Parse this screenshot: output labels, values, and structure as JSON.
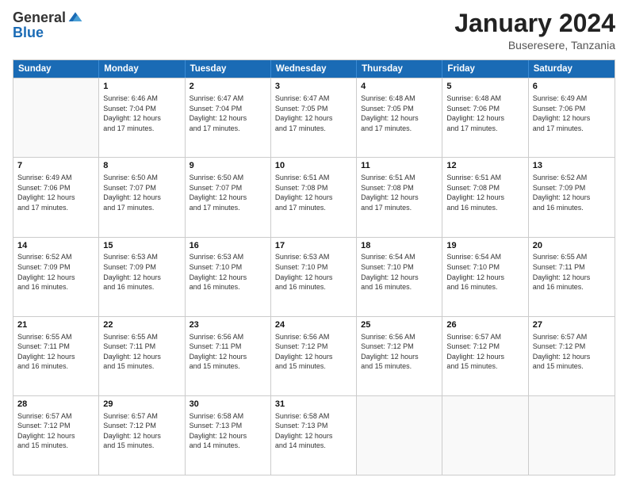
{
  "header": {
    "logo_general": "General",
    "logo_blue": "Blue",
    "month_title": "January 2024",
    "subtitle": "Buseresere, Tanzania"
  },
  "weekdays": [
    "Sunday",
    "Monday",
    "Tuesday",
    "Wednesday",
    "Thursday",
    "Friday",
    "Saturday"
  ],
  "rows": [
    [
      {
        "day": "",
        "info": "",
        "empty": true
      },
      {
        "day": "1",
        "info": "Sunrise: 6:46 AM\nSunset: 7:04 PM\nDaylight: 12 hours\nand 17 minutes."
      },
      {
        "day": "2",
        "info": "Sunrise: 6:47 AM\nSunset: 7:04 PM\nDaylight: 12 hours\nand 17 minutes."
      },
      {
        "day": "3",
        "info": "Sunrise: 6:47 AM\nSunset: 7:05 PM\nDaylight: 12 hours\nand 17 minutes."
      },
      {
        "day": "4",
        "info": "Sunrise: 6:48 AM\nSunset: 7:05 PM\nDaylight: 12 hours\nand 17 minutes."
      },
      {
        "day": "5",
        "info": "Sunrise: 6:48 AM\nSunset: 7:06 PM\nDaylight: 12 hours\nand 17 minutes."
      },
      {
        "day": "6",
        "info": "Sunrise: 6:49 AM\nSunset: 7:06 PM\nDaylight: 12 hours\nand 17 minutes."
      }
    ],
    [
      {
        "day": "7",
        "info": "Sunrise: 6:49 AM\nSunset: 7:06 PM\nDaylight: 12 hours\nand 17 minutes."
      },
      {
        "day": "8",
        "info": "Sunrise: 6:50 AM\nSunset: 7:07 PM\nDaylight: 12 hours\nand 17 minutes."
      },
      {
        "day": "9",
        "info": "Sunrise: 6:50 AM\nSunset: 7:07 PM\nDaylight: 12 hours\nand 17 minutes."
      },
      {
        "day": "10",
        "info": "Sunrise: 6:51 AM\nSunset: 7:08 PM\nDaylight: 12 hours\nand 17 minutes."
      },
      {
        "day": "11",
        "info": "Sunrise: 6:51 AM\nSunset: 7:08 PM\nDaylight: 12 hours\nand 17 minutes."
      },
      {
        "day": "12",
        "info": "Sunrise: 6:51 AM\nSunset: 7:08 PM\nDaylight: 12 hours\nand 16 minutes."
      },
      {
        "day": "13",
        "info": "Sunrise: 6:52 AM\nSunset: 7:09 PM\nDaylight: 12 hours\nand 16 minutes."
      }
    ],
    [
      {
        "day": "14",
        "info": "Sunrise: 6:52 AM\nSunset: 7:09 PM\nDaylight: 12 hours\nand 16 minutes."
      },
      {
        "day": "15",
        "info": "Sunrise: 6:53 AM\nSunset: 7:09 PM\nDaylight: 12 hours\nand 16 minutes."
      },
      {
        "day": "16",
        "info": "Sunrise: 6:53 AM\nSunset: 7:10 PM\nDaylight: 12 hours\nand 16 minutes."
      },
      {
        "day": "17",
        "info": "Sunrise: 6:53 AM\nSunset: 7:10 PM\nDaylight: 12 hours\nand 16 minutes."
      },
      {
        "day": "18",
        "info": "Sunrise: 6:54 AM\nSunset: 7:10 PM\nDaylight: 12 hours\nand 16 minutes."
      },
      {
        "day": "19",
        "info": "Sunrise: 6:54 AM\nSunset: 7:10 PM\nDaylight: 12 hours\nand 16 minutes."
      },
      {
        "day": "20",
        "info": "Sunrise: 6:55 AM\nSunset: 7:11 PM\nDaylight: 12 hours\nand 16 minutes."
      }
    ],
    [
      {
        "day": "21",
        "info": "Sunrise: 6:55 AM\nSunset: 7:11 PM\nDaylight: 12 hours\nand 16 minutes."
      },
      {
        "day": "22",
        "info": "Sunrise: 6:55 AM\nSunset: 7:11 PM\nDaylight: 12 hours\nand 15 minutes."
      },
      {
        "day": "23",
        "info": "Sunrise: 6:56 AM\nSunset: 7:11 PM\nDaylight: 12 hours\nand 15 minutes."
      },
      {
        "day": "24",
        "info": "Sunrise: 6:56 AM\nSunset: 7:12 PM\nDaylight: 12 hours\nand 15 minutes."
      },
      {
        "day": "25",
        "info": "Sunrise: 6:56 AM\nSunset: 7:12 PM\nDaylight: 12 hours\nand 15 minutes."
      },
      {
        "day": "26",
        "info": "Sunrise: 6:57 AM\nSunset: 7:12 PM\nDaylight: 12 hours\nand 15 minutes."
      },
      {
        "day": "27",
        "info": "Sunrise: 6:57 AM\nSunset: 7:12 PM\nDaylight: 12 hours\nand 15 minutes."
      }
    ],
    [
      {
        "day": "28",
        "info": "Sunrise: 6:57 AM\nSunset: 7:12 PM\nDaylight: 12 hours\nand 15 minutes."
      },
      {
        "day": "29",
        "info": "Sunrise: 6:57 AM\nSunset: 7:12 PM\nDaylight: 12 hours\nand 15 minutes."
      },
      {
        "day": "30",
        "info": "Sunrise: 6:58 AM\nSunset: 7:13 PM\nDaylight: 12 hours\nand 14 minutes."
      },
      {
        "day": "31",
        "info": "Sunrise: 6:58 AM\nSunset: 7:13 PM\nDaylight: 12 hours\nand 14 minutes."
      },
      {
        "day": "",
        "info": "",
        "empty": true
      },
      {
        "day": "",
        "info": "",
        "empty": true
      },
      {
        "day": "",
        "info": "",
        "empty": true
      }
    ]
  ]
}
